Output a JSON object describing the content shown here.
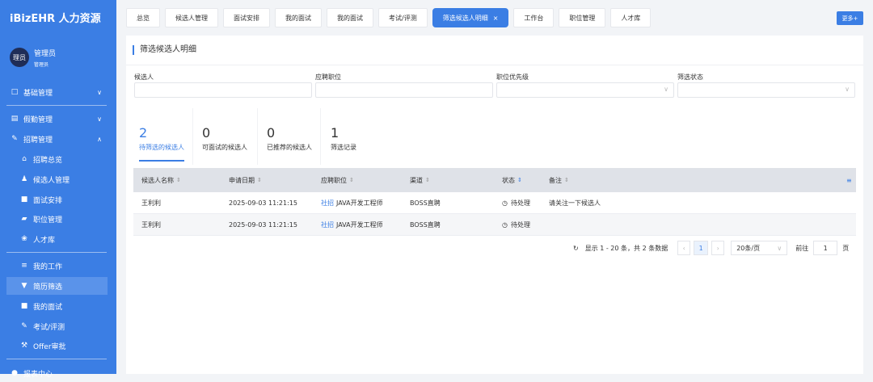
{
  "sidebar": {
    "brand": "iBizEHR 人力资源",
    "avatar_text": "理员",
    "user_name": "管理员",
    "user_role": "管理员",
    "items": [
      {
        "label": "基础管理",
        "icon": "□"
      },
      {
        "label": "假勤管理",
        "icon": "▤"
      },
      {
        "label": "招聘管理",
        "icon": "✎"
      },
      {
        "label": "招聘总览",
        "icon": "⌂"
      },
      {
        "label": "候选人管理",
        "icon": "♟"
      },
      {
        "label": "面试安排",
        "icon": "■"
      },
      {
        "label": "职位管理",
        "icon": "▰"
      },
      {
        "label": "人才库",
        "icon": "❀"
      },
      {
        "label": "我的工作",
        "icon": "≡"
      },
      {
        "label": "简历筛选",
        "icon": "▼"
      },
      {
        "label": "我的面试",
        "icon": "■"
      },
      {
        "label": "考试/评测",
        "icon": "✎"
      },
      {
        "label": "Offer审批",
        "icon": "⚒"
      },
      {
        "label": "报表中心",
        "icon": "●"
      }
    ]
  },
  "tabs": [
    "总览",
    "候选人管理",
    "面试安排",
    "我的面试",
    "我的面试",
    "考试/评测",
    "筛选候选人明细",
    "工作台",
    "职位管理",
    "人才库"
  ],
  "tab_close": "×",
  "more_label": "更多+",
  "page_title": "筛选候选人明细",
  "filters": [
    {
      "label": "候选人",
      "value": ""
    },
    {
      "label": "应聘职位",
      "value": ""
    },
    {
      "label": "职位优先级",
      "value": ""
    },
    {
      "label": "筛选状态",
      "value": ""
    }
  ],
  "stats": [
    {
      "num": "2",
      "label": "待筛选的候选人"
    },
    {
      "num": "0",
      "label": "可面试的候选人"
    },
    {
      "num": "0",
      "label": "已推荐的候选人"
    },
    {
      "num": "1",
      "label": "筛选记录"
    }
  ],
  "table": {
    "headers": [
      "候选人名称",
      "申请日期",
      "应聘职位",
      "渠道",
      "状态",
      "备注"
    ],
    "rows": [
      {
        "name": "王利利",
        "date": "2025-09-03 11:21:15",
        "tag": "社招",
        "position": "JAVA开发工程师",
        "channel": "BOSS直聘",
        "status": "待处理",
        "note": "请关注一下候选人"
      },
      {
        "name": "王利利",
        "date": "2025-09-03 11:21:15",
        "tag": "社招",
        "position": "JAVA开发工程师",
        "channel": "BOSS直聘",
        "status": "待处理",
        "note": ""
      }
    ]
  },
  "pagination": {
    "summary": "显示 1 - 20 条，共 2 条数据",
    "current": "1",
    "page_size": "20条/页",
    "goto_label": "前往",
    "goto_value": "1",
    "page_unit": "页"
  }
}
